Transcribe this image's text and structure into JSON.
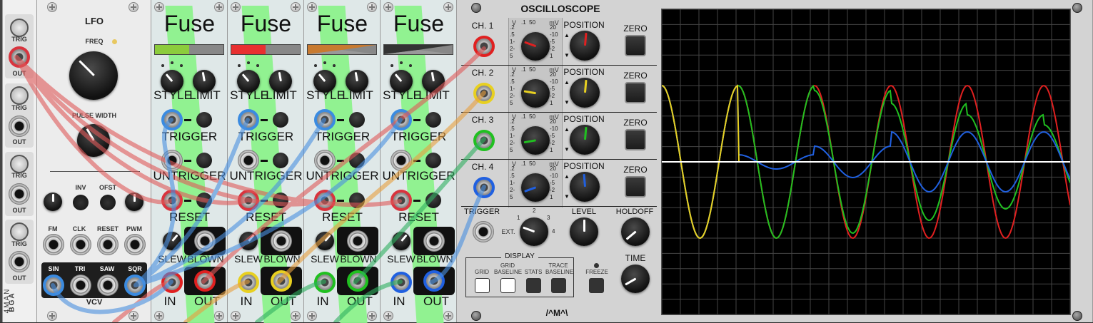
{
  "blank": {
    "brand": "4MAN",
    "brand2": "BGA"
  },
  "jackstrip": {
    "labels": [
      "TRIG",
      "OUT",
      "TRIG",
      "OUT",
      "TRIG",
      "OUT",
      "TRIG",
      "OUT"
    ]
  },
  "lfo": {
    "title": "LFO",
    "freq_label": "FREQ",
    "pw_label": "PULSE WIDTH",
    "inv_label": "INV",
    "ofst_label": "OFST",
    "inputs": [
      "FM",
      "CLK",
      "RESET",
      "PWM"
    ],
    "outputs": [
      "SIN",
      "TRI",
      "SAW",
      "SQR"
    ],
    "logo": "VCV"
  },
  "fuses": [
    {
      "title": "Fuse",
      "style": "STYLE",
      "limit": "LIMIT",
      "trigger": "TRIGGER",
      "untrigger": "UNTRIGGER",
      "reset": "RESET",
      "slew": "SLEW",
      "blown": "BLOWN",
      "in": "IN",
      "out": "OUT",
      "meter": "split-green"
    },
    {
      "title": "Fuse",
      "style": "STYLE",
      "limit": "LIMIT",
      "trigger": "TRIGGER",
      "untrigger": "UNTRIGGER",
      "reset": "RESET",
      "slew": "SLEW",
      "blown": "BLOWN",
      "in": "IN",
      "out": "OUT",
      "meter": "split-red"
    },
    {
      "title": "Fuse",
      "style": "STYLE",
      "limit": "LIMIT",
      "trigger": "TRIGGER",
      "untrigger": "UNTRIGGER",
      "reset": "RESET",
      "slew": "SLEW",
      "blown": "BLOWN",
      "in": "IN",
      "out": "OUT",
      "meter": "wedge-orange"
    },
    {
      "title": "Fuse",
      "style": "STYLE",
      "limit": "LIMIT",
      "trigger": "TRIGGER",
      "untrigger": "UNTRIGGER",
      "reset": "RESET",
      "slew": "SLEW",
      "blown": "BLOWN",
      "in": "IN",
      "out": "OUT",
      "meter": "wedge-dark"
    }
  ],
  "scope": {
    "title": "OSCILLOSCOPE",
    "channels": [
      {
        "label": "CH. 1",
        "color": "#e02020"
      },
      {
        "label": "CH. 2",
        "color": "#e8d020"
      },
      {
        "label": "CH. 3",
        "color": "#20c020"
      },
      {
        "label": "CH. 4",
        "color": "#2060e0"
      }
    ],
    "position_label": "POSITION",
    "zero_label": "ZERO",
    "trigger_label": "TRIGGER",
    "ext_label": "EXT.",
    "level_label": "LEVEL",
    "holdoff_label": "HOLDOFF",
    "time_label": "TIME",
    "display_label": "DISPLAY",
    "display_buttons": [
      "GRID",
      "GRID BASELINE",
      "STATS",
      "TRACE BASELINE"
    ],
    "freeze_label": "FREEZE",
    "logo": "/^M^\\",
    "scale_v": "V",
    "scale_mv": "mV"
  }
}
